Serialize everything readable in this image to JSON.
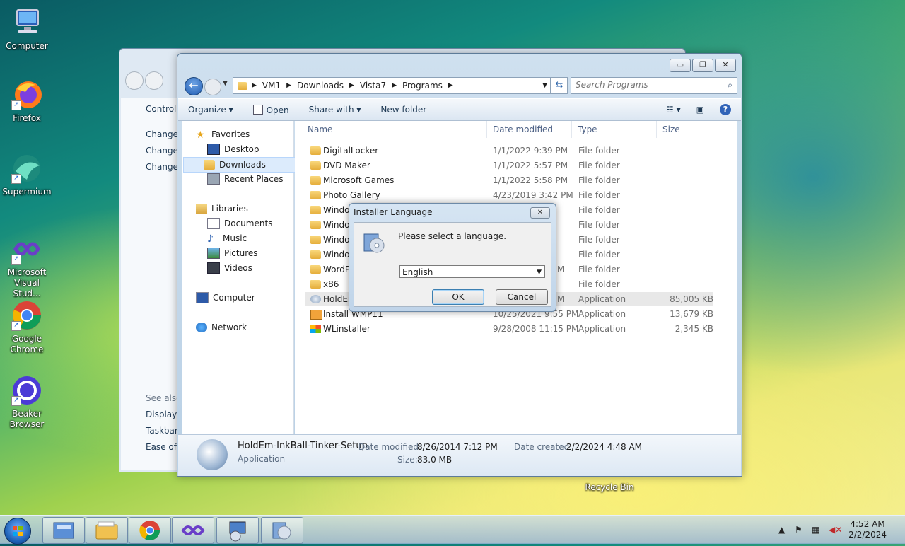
{
  "desktop": {
    "icons": [
      {
        "label": "Computer"
      },
      {
        "label": "Firefox"
      },
      {
        "label": "Supermium"
      },
      {
        "label": "Microsoft Visual Stud..."
      },
      {
        "label": "Google Chrome"
      },
      {
        "label": "Beaker Browser"
      },
      {
        "label": "Recycle Bin"
      }
    ]
  },
  "back_window": {
    "left_items": [
      "Control I",
      "Change",
      "Change",
      "Change"
    ],
    "see_also": "See also",
    "see_also_items": [
      "Display",
      "Taskbar",
      "Ease of A"
    ]
  },
  "explorer": {
    "caption_buttons": {
      "minimize": "▭",
      "maximize": "❐",
      "close": "✕"
    },
    "breadcrumbs": [
      "VM1",
      "Downloads",
      "Vista7",
      "Programs"
    ],
    "search_placeholder": "Search Programs",
    "toolbar": {
      "organize": "Organize ▾",
      "open": "Open",
      "share_with": "Share with ▾",
      "new_folder": "New folder"
    },
    "nav": {
      "favorites": "Favorites",
      "desktop": "Desktop",
      "downloads": "Downloads",
      "recent": "Recent Places",
      "libraries": "Libraries",
      "documents": "Documents",
      "music": "Music",
      "pictures": "Pictures",
      "videos": "Videos",
      "computer": "Computer",
      "network": "Network"
    },
    "columns": {
      "name": "Name",
      "date": "Date modified",
      "type": "Type",
      "size": "Size"
    },
    "rows": [
      {
        "name": "DigitalLocker",
        "date": "1/1/2022 9:39 PM",
        "type": "File folder",
        "size": ""
      },
      {
        "name": "DVD Maker",
        "date": "1/1/2022 5:57 PM",
        "type": "File folder",
        "size": ""
      },
      {
        "name": "Microsoft Games",
        "date": "1/1/2022 5:58 PM",
        "type": "File folder",
        "size": ""
      },
      {
        "name": "Photo Gallery",
        "date": "4/23/2019 3:42 PM",
        "type": "File folder",
        "size": ""
      },
      {
        "name": "Window",
        "date": "",
        "type": "File folder",
        "size": ""
      },
      {
        "name": "Window",
        "date": "",
        "type": "File folder",
        "size": ""
      },
      {
        "name": "Window",
        "date": "",
        "type": "File folder",
        "size": ""
      },
      {
        "name": "Window",
        "date": "",
        "type": "File folder",
        "size": ""
      },
      {
        "name": "WordP",
        "date": "M",
        "type": "File folder",
        "size": ""
      },
      {
        "name": "x86",
        "date": "",
        "type": "File folder",
        "size": ""
      },
      {
        "name": "HoldEm",
        "date": "M",
        "type": "Application",
        "size": "85,005 KB"
      },
      {
        "name": "Install WMP11",
        "date": "10/25/2021 9:55 PM",
        "type": "Application",
        "size": "13,679 KB"
      },
      {
        "name": "WLinstaller",
        "date": "9/28/2008 11:15 PM",
        "type": "Application",
        "size": "2,345 KB"
      }
    ],
    "details": {
      "name": "HoldEm-InkBall-Tinker-Setup",
      "kind": "Application",
      "date_modified_label": "Date modified:",
      "date_modified": "8/26/2014 7:12 PM",
      "size_label": "Size:",
      "size": "83.0 MB",
      "date_created_label": "Date created:",
      "date_created": "2/2/2024 4:48 AM"
    }
  },
  "dialog": {
    "title": "Installer Language",
    "close": "✕",
    "message": "Please select a language.",
    "selected_language": "English",
    "ok": "OK",
    "cancel": "Cancel"
  },
  "taskbar": {
    "time": "4:52 AM",
    "date": "2/2/2024"
  }
}
